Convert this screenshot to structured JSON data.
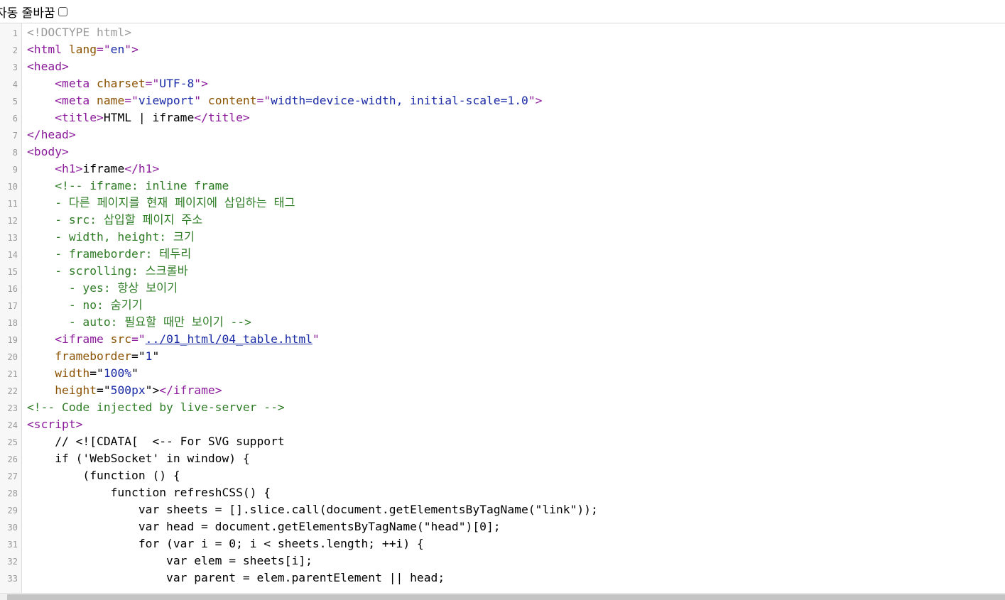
{
  "toolbar": {
    "wrap_label": "자동 줄바꿈",
    "wrap_checked": false
  },
  "lines": [
    {
      "n": "1",
      "segs": [
        {
          "t": "<!DOCTYPE html>",
          "c": "doc"
        }
      ]
    },
    {
      "n": "2",
      "segs": [
        {
          "t": "<html ",
          "c": "tag"
        },
        {
          "t": "lang",
          "c": "attr"
        },
        {
          "t": "=\"",
          "c": "tag"
        },
        {
          "t": "en",
          "c": "val"
        },
        {
          "t": "\">",
          "c": "tag"
        }
      ]
    },
    {
      "n": "3",
      "segs": [
        {
          "t": "<head>",
          "c": "tag"
        }
      ]
    },
    {
      "n": "4",
      "segs": [
        {
          "t": "    "
        },
        {
          "t": "<meta ",
          "c": "tag"
        },
        {
          "t": "charset",
          "c": "attr"
        },
        {
          "t": "=\"",
          "c": "tag"
        },
        {
          "t": "UTF-8",
          "c": "val"
        },
        {
          "t": "\">",
          "c": "tag"
        }
      ]
    },
    {
      "n": "5",
      "segs": [
        {
          "t": "    "
        },
        {
          "t": "<meta ",
          "c": "tag"
        },
        {
          "t": "name",
          "c": "attr"
        },
        {
          "t": "=\"",
          "c": "tag"
        },
        {
          "t": "viewport",
          "c": "val"
        },
        {
          "t": "\" ",
          "c": "tag"
        },
        {
          "t": "content",
          "c": "attr"
        },
        {
          "t": "=\"",
          "c": "tag"
        },
        {
          "t": "width=device-width, initial-scale=1.0",
          "c": "val"
        },
        {
          "t": "\">",
          "c": "tag"
        }
      ]
    },
    {
      "n": "6",
      "segs": [
        {
          "t": "    "
        },
        {
          "t": "<title>",
          "c": "tag"
        },
        {
          "t": "HTML | iframe"
        },
        {
          "t": "</title>",
          "c": "tag"
        }
      ]
    },
    {
      "n": "7",
      "segs": [
        {
          "t": "</head>",
          "c": "tag"
        }
      ]
    },
    {
      "n": "8",
      "segs": [
        {
          "t": "<body>",
          "c": "tag"
        }
      ]
    },
    {
      "n": "9",
      "segs": [
        {
          "t": "    "
        },
        {
          "t": "<h1>",
          "c": "tag"
        },
        {
          "t": "iframe"
        },
        {
          "t": "</h1>",
          "c": "tag"
        }
      ]
    },
    {
      "n": "10",
      "segs": [
        {
          "t": "    <!-- iframe: inline frame",
          "c": "cmt"
        }
      ]
    },
    {
      "n": "11",
      "segs": [
        {
          "t": "    - 다른 페이지를 현재 페이지에 삽입하는 태그",
          "c": "cmt"
        }
      ]
    },
    {
      "n": "12",
      "segs": [
        {
          "t": "    - src: 삽입할 페이지 주소",
          "c": "cmt"
        }
      ]
    },
    {
      "n": "13",
      "segs": [
        {
          "t": "    - width, height: 크기",
          "c": "cmt"
        }
      ]
    },
    {
      "n": "14",
      "segs": [
        {
          "t": "    - frameborder: 테두리",
          "c": "cmt"
        }
      ]
    },
    {
      "n": "15",
      "segs": [
        {
          "t": "    - scrolling: 스크롤바",
          "c": "cmt"
        }
      ]
    },
    {
      "n": "16",
      "segs": [
        {
          "t": "      - yes: 항상 보이기",
          "c": "cmt"
        }
      ]
    },
    {
      "n": "17",
      "segs": [
        {
          "t": "      - no: 숨기기",
          "c": "cmt"
        }
      ]
    },
    {
      "n": "18",
      "segs": [
        {
          "t": "      - auto: 필요할 때만 보이기 -->",
          "c": "cmt"
        }
      ]
    },
    {
      "n": "19",
      "segs": [
        {
          "t": "    "
        },
        {
          "t": "<iframe ",
          "c": "tag"
        },
        {
          "t": "src",
          "c": "attr"
        },
        {
          "t": "=\"",
          "c": "tag"
        },
        {
          "t": "../01_html/04_table.html",
          "c": "link"
        },
        {
          "t": "\"",
          "c": "tag"
        }
      ]
    },
    {
      "n": "20",
      "segs": [
        {
          "t": "    "
        },
        {
          "t": "frameborder",
          "c": "attr"
        },
        {
          "t": "=\""
        },
        {
          "t": "1",
          "c": "val"
        },
        {
          "t": "\""
        }
      ]
    },
    {
      "n": "21",
      "segs": [
        {
          "t": "    "
        },
        {
          "t": "width",
          "c": "attr"
        },
        {
          "t": "=\""
        },
        {
          "t": "100%",
          "c": "val"
        },
        {
          "t": "\""
        }
      ]
    },
    {
      "n": "22",
      "segs": [
        {
          "t": "    "
        },
        {
          "t": "height",
          "c": "attr"
        },
        {
          "t": "=\""
        },
        {
          "t": "500px",
          "c": "val"
        },
        {
          "t": "\">"
        },
        {
          "t": "</iframe>",
          "c": "tag"
        }
      ]
    },
    {
      "n": "23",
      "segs": [
        {
          "t": "<!-- Code injected by live-server -->",
          "c": "cmt"
        }
      ]
    },
    {
      "n": "24",
      "segs": [
        {
          "t": "<script>",
          "c": "tag"
        }
      ]
    },
    {
      "n": "25",
      "segs": [
        {
          "t": "    // <![CDATA[  <-- For SVG support"
        }
      ]
    },
    {
      "n": "26",
      "segs": [
        {
          "t": "    if ('WebSocket' in window) {"
        }
      ]
    },
    {
      "n": "27",
      "segs": [
        {
          "t": "        (function () {"
        }
      ]
    },
    {
      "n": "28",
      "segs": [
        {
          "t": "            function refreshCSS() {"
        }
      ]
    },
    {
      "n": "29",
      "segs": [
        {
          "t": "                var sheets = [].slice.call(document.getElementsByTagName(\"link\"));"
        }
      ]
    },
    {
      "n": "30",
      "segs": [
        {
          "t": "                var head = document.getElementsByTagName(\"head\")[0];"
        }
      ]
    },
    {
      "n": "31",
      "segs": [
        {
          "t": "                for (var i = 0; i < sheets.length; ++i) {"
        }
      ]
    },
    {
      "n": "32",
      "segs": [
        {
          "t": "                    var elem = sheets[i];"
        }
      ]
    },
    {
      "n": "33",
      "segs": [
        {
          "t": "                    var parent = elem.parentElement || head;"
        }
      ]
    }
  ]
}
